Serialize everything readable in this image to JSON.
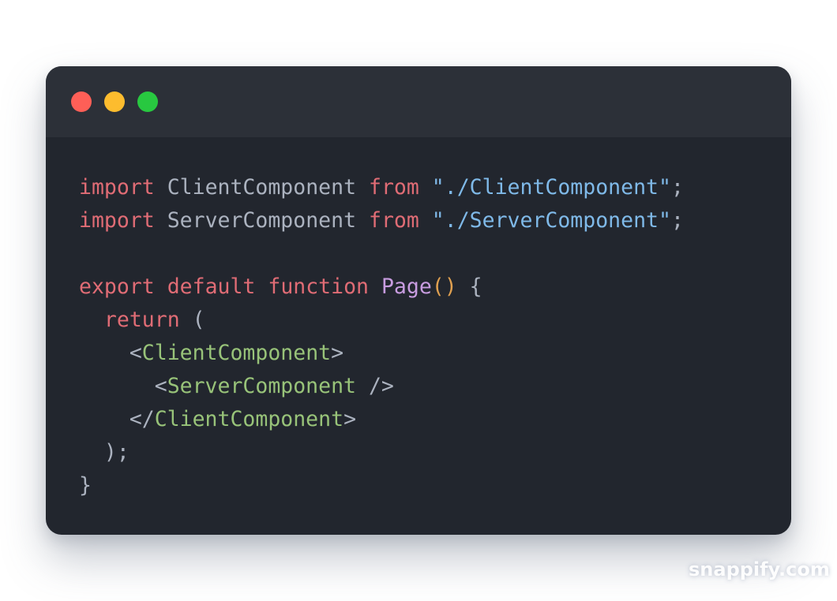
{
  "window": {
    "controls": [
      {
        "name": "close",
        "color": "#fe5f57"
      },
      {
        "name": "minimize",
        "color": "#fdbc2e"
      },
      {
        "name": "zoom",
        "color": "#28c840"
      }
    ]
  },
  "colors": {
    "keyword": "#e06c75",
    "identifier": "#abb2bf",
    "string": "#7fb9e8",
    "function": "#c89ce0",
    "paren": "#e0a050",
    "jsx_tag": "#98c379",
    "background": "#22262e",
    "titlebar": "#2c3038"
  },
  "code": {
    "language": "jsx",
    "lines": [
      {
        "tokens": [
          {
            "t": "import",
            "k": "kw"
          },
          {
            "t": " ",
            "k": "id"
          },
          {
            "t": "ClientComponent",
            "k": "id"
          },
          {
            "t": " ",
            "k": "id"
          },
          {
            "t": "from",
            "k": "kw"
          },
          {
            "t": " ",
            "k": "id"
          },
          {
            "t": "\"./ClientComponent\"",
            "k": "str"
          },
          {
            "t": ";",
            "k": "punc"
          }
        ]
      },
      {
        "tokens": [
          {
            "t": "import",
            "k": "kw"
          },
          {
            "t": " ",
            "k": "id"
          },
          {
            "t": "ServerComponent",
            "k": "id"
          },
          {
            "t": " ",
            "k": "id"
          },
          {
            "t": "from",
            "k": "kw"
          },
          {
            "t": " ",
            "k": "id"
          },
          {
            "t": "\"./ServerComponent\"",
            "k": "str"
          },
          {
            "t": ";",
            "k": "punc"
          }
        ]
      },
      {
        "tokens": []
      },
      {
        "tokens": [
          {
            "t": "export",
            "k": "kw"
          },
          {
            "t": " ",
            "k": "id"
          },
          {
            "t": "default",
            "k": "kw"
          },
          {
            "t": " ",
            "k": "id"
          },
          {
            "t": "function",
            "k": "kw"
          },
          {
            "t": " ",
            "k": "id"
          },
          {
            "t": "Page",
            "k": "fn"
          },
          {
            "t": "()",
            "k": "paren"
          },
          {
            "t": " {",
            "k": "punc"
          }
        ]
      },
      {
        "tokens": [
          {
            "t": "  ",
            "k": "id"
          },
          {
            "t": "return",
            "k": "kw"
          },
          {
            "t": " (",
            "k": "punc"
          }
        ]
      },
      {
        "tokens": [
          {
            "t": "    <",
            "k": "punc"
          },
          {
            "t": "ClientComponent",
            "k": "tag"
          },
          {
            "t": ">",
            "k": "punc"
          }
        ]
      },
      {
        "tokens": [
          {
            "t": "      <",
            "k": "punc"
          },
          {
            "t": "ServerComponent",
            "k": "tag"
          },
          {
            "t": " />",
            "k": "punc"
          }
        ]
      },
      {
        "tokens": [
          {
            "t": "    </",
            "k": "punc"
          },
          {
            "t": "ClientComponent",
            "k": "tag"
          },
          {
            "t": ">",
            "k": "punc"
          }
        ]
      },
      {
        "tokens": [
          {
            "t": "  );",
            "k": "punc"
          }
        ]
      },
      {
        "tokens": [
          {
            "t": "}",
            "k": "punc"
          }
        ]
      }
    ]
  },
  "watermark": "snappify.com"
}
